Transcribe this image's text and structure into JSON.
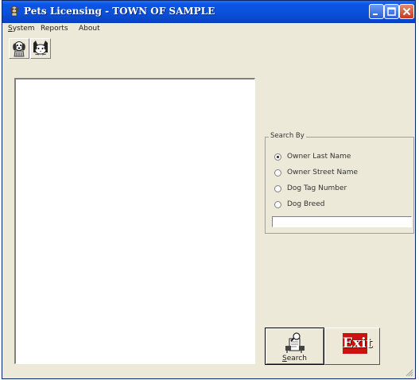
{
  "window": {
    "title": "Pets Licensing - TOWN OF SAMPLE"
  },
  "menu": {
    "items": [
      {
        "access_key": "S",
        "rest": "ystem"
      },
      {
        "access_key": "",
        "rest": "Reports"
      },
      {
        "access_key": "",
        "rest": "About"
      }
    ]
  },
  "toolbar": {
    "icons": [
      "dog-icon",
      "cat-icon"
    ]
  },
  "search_by": {
    "label": "Search By",
    "options": [
      {
        "label": "Owner Last Name",
        "selected": true
      },
      {
        "label": "Owner Street Name",
        "selected": false
      },
      {
        "label": "Dog Tag Number",
        "selected": false
      },
      {
        "label": "Dog Breed",
        "selected": false
      }
    ],
    "input_value": ""
  },
  "buttons": {
    "search_access_key": "S",
    "search_rest": "earch",
    "exit_icon_text": "Exit"
  },
  "colors": {
    "titlebar": "#0a4fd9",
    "window_bg": "#ece9d8",
    "exit_red": "#cc1111"
  }
}
